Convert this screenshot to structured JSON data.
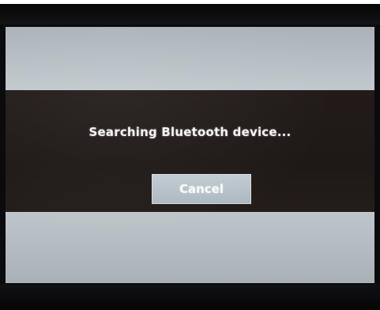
{
  "dialog": {
    "message": "Searching Bluetooth device...",
    "cancel_label": "Cancel"
  },
  "colors": {
    "screen_background": "#b9c1c7",
    "dialog_background": "#201a18",
    "button_background": "#b8c2ca",
    "text": "#f4f4f2"
  }
}
